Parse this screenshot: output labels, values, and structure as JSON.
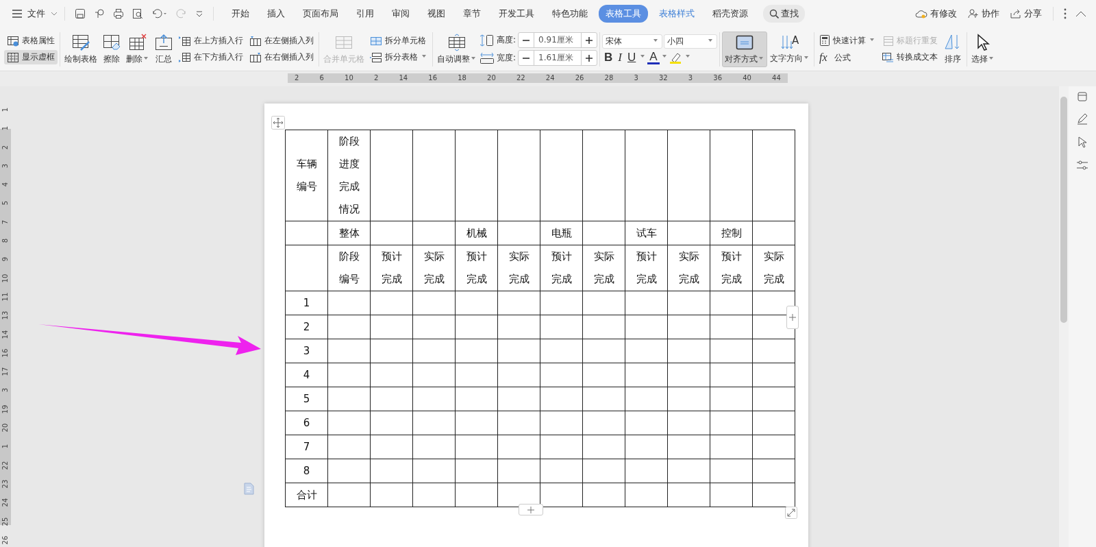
{
  "menu": {
    "label": "文件"
  },
  "tabs": [
    {
      "label": "开始",
      "selected": false,
      "kind": "plain"
    },
    {
      "label": "插入",
      "selected": false,
      "kind": "plain"
    },
    {
      "label": "页面布局",
      "selected": false,
      "kind": "plain"
    },
    {
      "label": "引用",
      "selected": false,
      "kind": "plain"
    },
    {
      "label": "审阅",
      "selected": false,
      "kind": "plain"
    },
    {
      "label": "视图",
      "selected": false,
      "kind": "plain"
    },
    {
      "label": "章节",
      "selected": false,
      "kind": "plain"
    },
    {
      "label": "开发工具",
      "selected": false,
      "kind": "plain"
    },
    {
      "label": "特色功能",
      "selected": false,
      "kind": "plain"
    },
    {
      "label": "表格工具",
      "selected": true,
      "kind": "plain"
    },
    {
      "label": "表格样式",
      "selected": false,
      "kind": "context"
    },
    {
      "label": "稻壳资源",
      "selected": false,
      "kind": "plain"
    }
  ],
  "search": {
    "label": "查找"
  },
  "top_actions": [
    {
      "label": "有修改"
    },
    {
      "label": "协作"
    },
    {
      "label": "分享"
    }
  ],
  "ribbon": {
    "table_properties": {
      "label": "表格属性"
    },
    "show_gridlines": {
      "label": "显示虚框",
      "selected": true
    },
    "draw_table": {
      "label": "绘制表格"
    },
    "erase": {
      "label": "擦除"
    },
    "delete": {
      "label": "删除"
    },
    "summary": {
      "label": "汇总"
    },
    "insert_row_above": {
      "label": "在上方插入行"
    },
    "insert_row_below": {
      "label": "在下方插入行"
    },
    "insert_col_left": {
      "label": "在左侧插入列"
    },
    "insert_col_right": {
      "label": "在右侧插入列"
    },
    "merge_cells": {
      "label": "合并单元格",
      "disabled": true
    },
    "split_cells": {
      "label": "拆分单元格"
    },
    "split_table": {
      "label": "拆分表格"
    },
    "auto_fit": {
      "label": "自动调整"
    },
    "height": {
      "label": "高度:",
      "value": "0.91厘米"
    },
    "width": {
      "label": "宽度:",
      "value": "1.61厘米"
    },
    "font": {
      "value": "宋体"
    },
    "font_size": {
      "value": "小四"
    },
    "bold": {
      "label": "B"
    },
    "italic": {
      "label": "I"
    },
    "underline": {
      "label": "U"
    },
    "font_color": {
      "label": "A"
    },
    "align": {
      "label": "对齐方式",
      "selected": true
    },
    "text_direction": {
      "label": "文字方向",
      "symbol": "A"
    },
    "quick_calc": {
      "label": "快速计算"
    },
    "repeat_header": {
      "label": "标题行重复",
      "disabled": true
    },
    "formula": {
      "label": "公式",
      "symbol": "fx"
    },
    "to_text": {
      "label": "转换成文本"
    },
    "sort": {
      "label": "排序"
    },
    "select": {
      "label": "选择"
    }
  },
  "rulers": {
    "horizontal": [
      "2",
      "6",
      "10",
      "2",
      "14",
      "16",
      "18",
      "20",
      "22",
      "24",
      "26",
      "28",
      "3",
      "32",
      "3",
      "36",
      "40",
      "44"
    ],
    "vertical": [
      "1",
      "1",
      "2",
      "3",
      "4",
      "5",
      "7",
      "8",
      "9",
      "10",
      "11",
      "13",
      "14",
      "16",
      "17",
      "3",
      "19",
      "20",
      "1",
      "22",
      "23",
      "24",
      "25",
      "26"
    ]
  },
  "table": {
    "rows": [
      [
        "车辆编号",
        "阶段进度完成情况",
        "",
        "",
        "",
        "",
        "",
        "",
        "",
        "",
        "",
        ""
      ],
      [
        "",
        "整体",
        "",
        "",
        "机械",
        "",
        "电瓶",
        "",
        "试车",
        "",
        "控制",
        ""
      ],
      [
        "",
        "阶段编号",
        "预计完成",
        "实际完成",
        "预计完成",
        "实际完成",
        "预计完成",
        "实际完成",
        "预计完成",
        "实际完成",
        "预计完成",
        "实际完成"
      ],
      [
        "1",
        "",
        "",
        "",
        "",
        "",
        "",
        "",
        "",
        "",
        "",
        ""
      ],
      [
        "2",
        "",
        "",
        "",
        "",
        "",
        "",
        "",
        "",
        "",
        "",
        ""
      ],
      [
        "3",
        "",
        "",
        "",
        "",
        "",
        "",
        "",
        "",
        "",
        "",
        ""
      ],
      [
        "4",
        "",
        "",
        "",
        "",
        "",
        "",
        "",
        "",
        "",
        "",
        ""
      ],
      [
        "5",
        "",
        "",
        "",
        "",
        "",
        "",
        "",
        "",
        "",
        "",
        ""
      ],
      [
        "6",
        "",
        "",
        "",
        "",
        "",
        "",
        "",
        "",
        "",
        "",
        ""
      ],
      [
        "7",
        "",
        "",
        "",
        "",
        "",
        "",
        "",
        "",
        "",
        "",
        ""
      ],
      [
        "8",
        "",
        "",
        "",
        "",
        "",
        "",
        "",
        "",
        "",
        "",
        ""
      ],
      [
        "合计",
        "",
        "",
        "",
        "",
        "",
        "",
        "",
        "",
        "",
        "",
        ""
      ]
    ]
  }
}
